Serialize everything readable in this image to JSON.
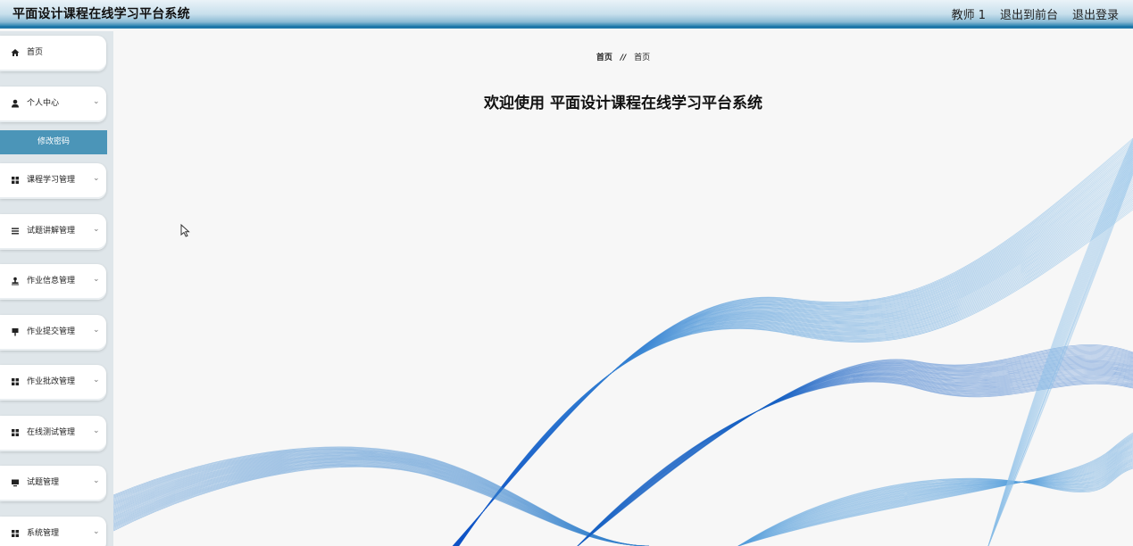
{
  "header": {
    "title": "平面设计课程在线学习平台系统",
    "links": {
      "user": "教师 1",
      "front": "退出到前台",
      "logout": "退出登录"
    }
  },
  "sidebar": {
    "items": [
      {
        "label": "首页",
        "icon": "home-icon",
        "chevron": false
      },
      {
        "label": "个人中心",
        "icon": "user-icon",
        "chevron": true
      },
      {
        "label": "课程学习管理",
        "icon": "grid-icon",
        "chevron": true
      },
      {
        "label": "试题讲解管理",
        "icon": "list-icon",
        "chevron": true
      },
      {
        "label": "作业信息管理",
        "icon": "stamp-icon",
        "chevron": true
      },
      {
        "label": "作业提交管理",
        "icon": "flag-icon",
        "chevron": true
      },
      {
        "label": "作业批改管理",
        "icon": "grid-icon",
        "chevron": true
      },
      {
        "label": "在线测试管理",
        "icon": "grid-icon",
        "chevron": true
      },
      {
        "label": "试题管理",
        "icon": "monitor-icon",
        "chevron": true
      },
      {
        "label": "系统管理",
        "icon": "grid-icon",
        "chevron": true
      }
    ],
    "subitem": {
      "label": "修改密码"
    },
    "chevron_glyph": "⌄"
  },
  "breadcrumb": {
    "home": "首页",
    "separator": "//",
    "current": "首页"
  },
  "main": {
    "welcome": "欢迎使用 平面设计课程在线学习平台系统"
  },
  "colors": {
    "accent": "#1f77a8",
    "sub_active": "#4b95b8",
    "wave": "#1560c0"
  }
}
